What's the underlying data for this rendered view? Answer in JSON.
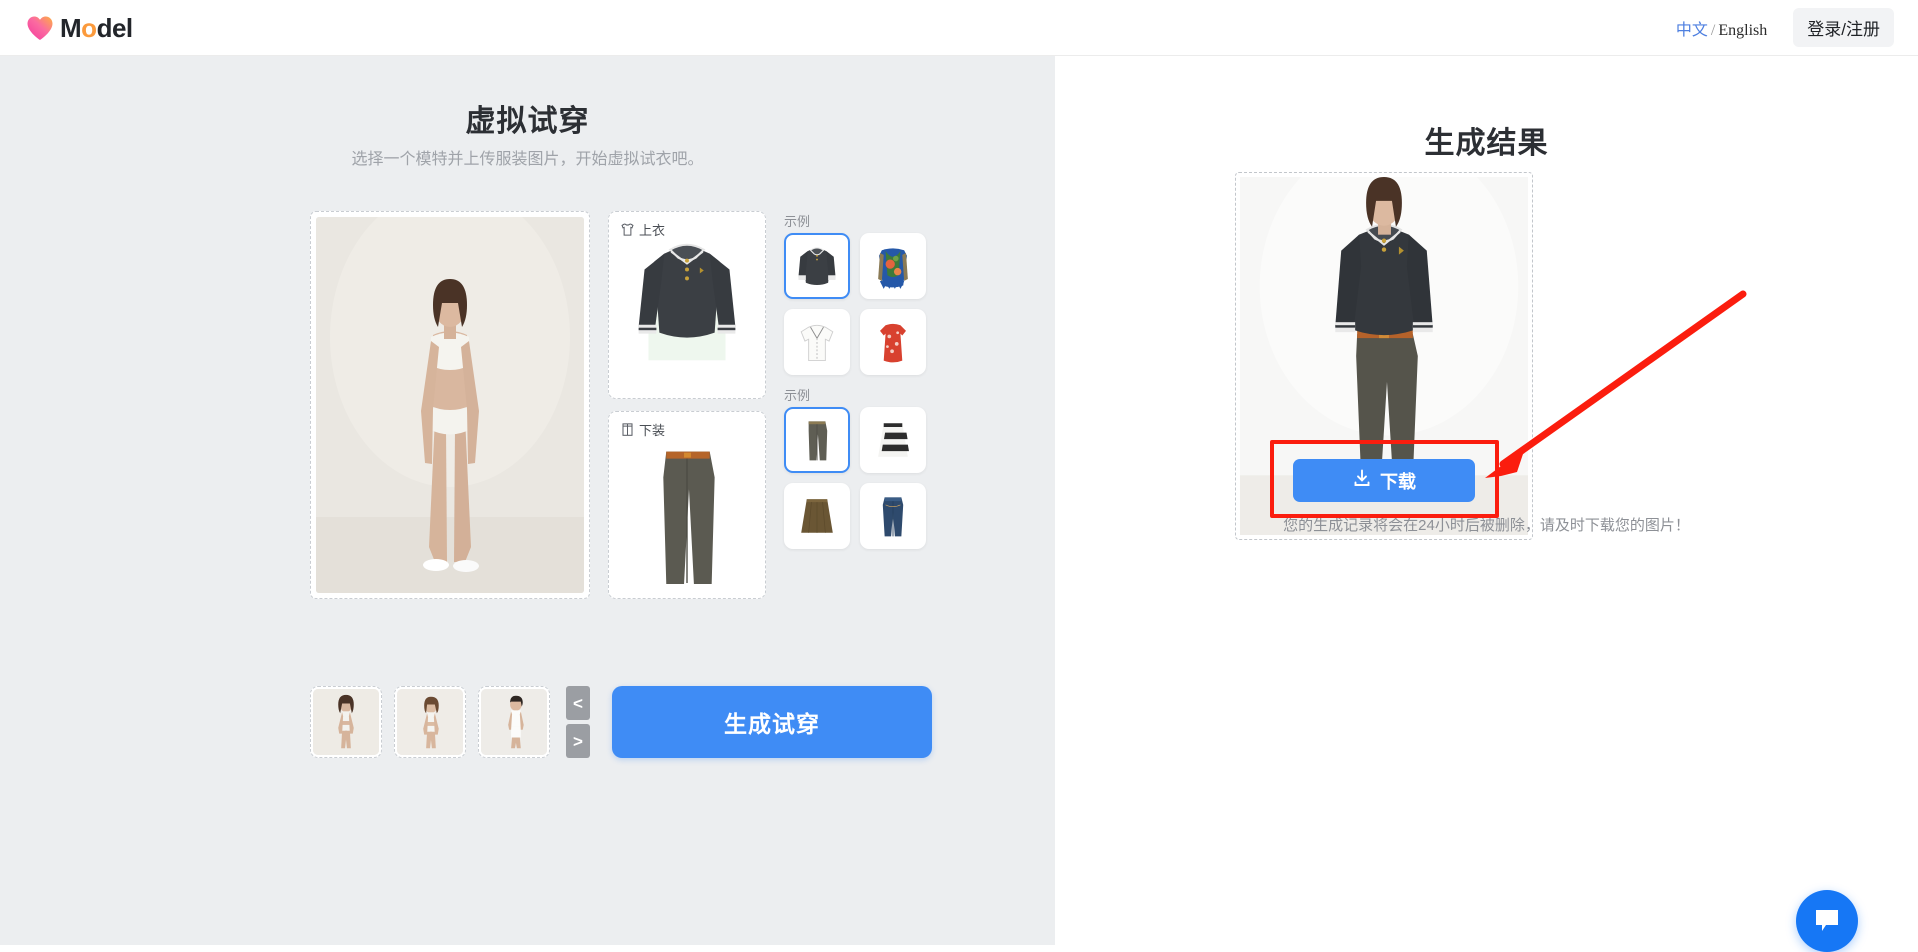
{
  "header": {
    "logo_text_a": "M",
    "logo_text_o": "o",
    "logo_text_b": "del",
    "logo_icon": "heart-icon",
    "lang_active": "中文",
    "lang_sep": "/",
    "lang_other": "English",
    "login_label": "登录/注册"
  },
  "left": {
    "title": "虚拟试穿",
    "subtitle": "选择一个模特并上传服装图片，开始虚拟试衣吧。",
    "model_preview_alt": "模特预览",
    "slots": [
      {
        "label": "上衣",
        "icon": "top-garment-icon"
      },
      {
        "label": "下装",
        "icon": "bottom-garment-icon"
      }
    ],
    "example_groups": [
      {
        "label": "示例",
        "items": [
          {
            "name": "dark-polo-sweater",
            "selected": true
          },
          {
            "name": "floral-knit-vest",
            "selected": false
          },
          {
            "name": "white-short-sleeve-shirt",
            "selected": false
          },
          {
            "name": "red-floral-dress",
            "selected": false
          }
        ]
      },
      {
        "label": "示例",
        "items": [
          {
            "name": "gray-wide-leg-trousers",
            "selected": true
          },
          {
            "name": "black-white-striped-skirt",
            "selected": false
          },
          {
            "name": "brown-leather-skirt",
            "selected": false
          },
          {
            "name": "blue-denim-jeans",
            "selected": false
          }
        ]
      }
    ],
    "model_thumbs": [
      {
        "name": "model-female-1",
        "selected": true
      },
      {
        "name": "model-female-2",
        "selected": false
      },
      {
        "name": "model-male-1",
        "selected": false
      }
    ],
    "prev_label": "<",
    "next_label": ">",
    "generate_label": "生成试穿"
  },
  "right": {
    "title": "生成结果",
    "result_alt": "生成的试穿结果",
    "download_label": "下载",
    "download_icon": "download-icon",
    "notice": "您的生成记录将会在24小时后被删除，请及时下载您的图片！"
  },
  "chat": {
    "icon": "chat-bubble-icon"
  },
  "colors": {
    "accent_blue": "#3f8cf5",
    "annotation_red": "#fb1d0e",
    "panel_gray": "#eceef0",
    "chat_blue": "#1677f5"
  }
}
